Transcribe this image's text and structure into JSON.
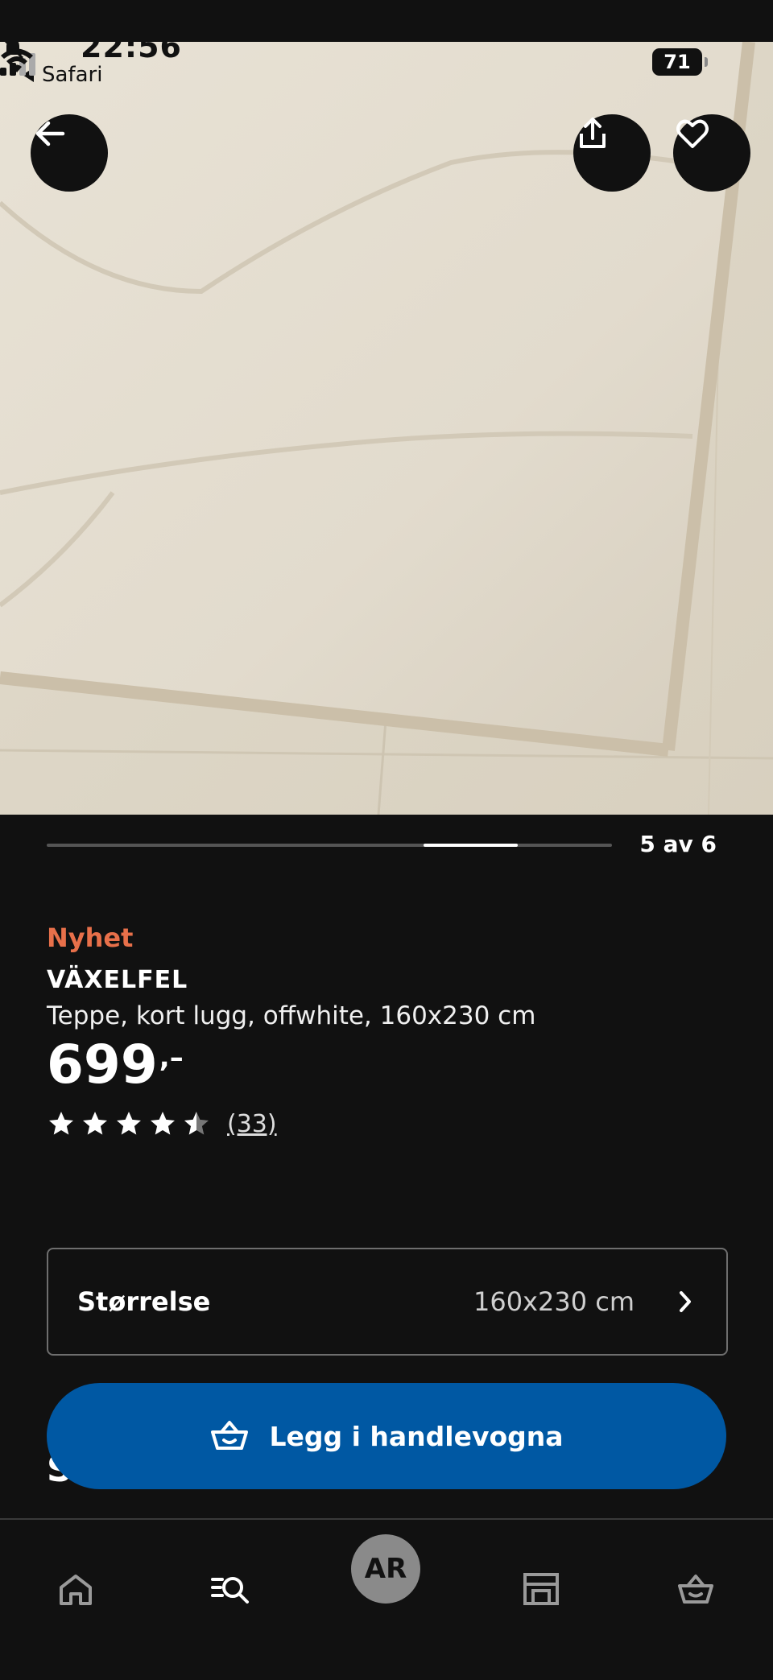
{
  "status_bar": {
    "time": "22:56",
    "back_app": "Safari",
    "battery": "71"
  },
  "carousel": {
    "indicator": "5 av 6",
    "current": 5,
    "total": 6
  },
  "product": {
    "badge": "Nyhet",
    "name": "VÄXELFEL",
    "description": "Teppe, kort lugg, offwhite, 160x230 cm",
    "price_int": "699",
    "price_suffix": ",–",
    "rating_stars": 4.5,
    "review_count": "(33)"
  },
  "size_selector": {
    "label": "Størrelse",
    "value": "160x230 cm"
  },
  "cta": {
    "label": "Legg i handlevogna"
  },
  "peek_heading": "Se",
  "bottom_nav": {
    "ar_label": "AR"
  },
  "colors": {
    "accent_new": "#e8704a",
    "cta_blue": "#0058a3",
    "background": "#111111"
  },
  "icons": [
    "arrow-left-icon",
    "share-icon",
    "heart-icon",
    "chevron-right-icon",
    "cart-icon",
    "home-icon",
    "search-icon",
    "store-icon",
    "basket-icon",
    "bell-slash-icon",
    "signal-icon",
    "wifi-icon"
  ]
}
